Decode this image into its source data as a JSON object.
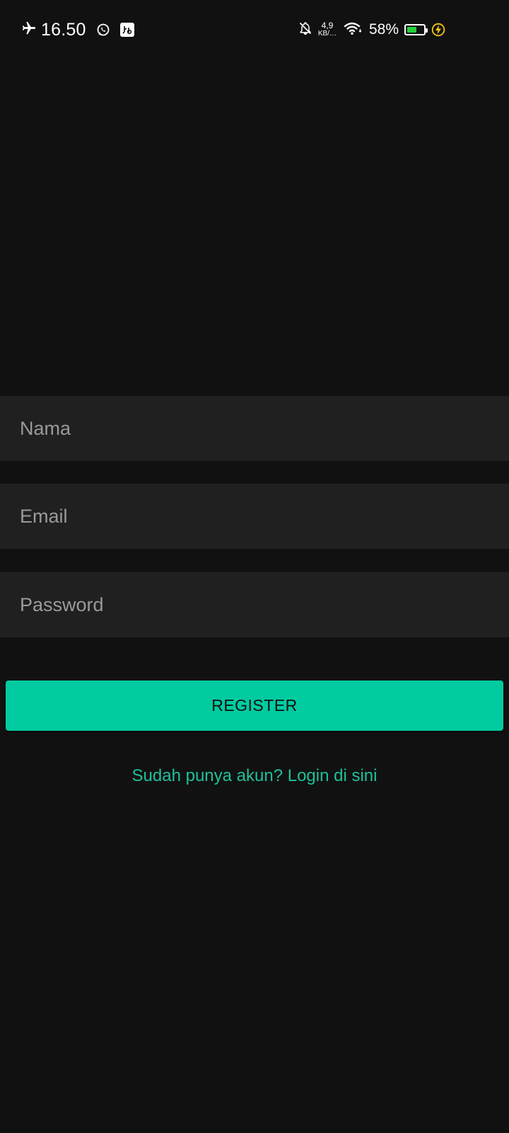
{
  "status_bar": {
    "time": "16.50",
    "airplane_icon": "airplane-icon",
    "apps": [
      "whatsapp-icon",
      "usb-debugging-icon"
    ],
    "mute_icon": "bell-off-icon",
    "net_speed_value": "4,9",
    "net_speed_unit": "KB/…",
    "wifi_icon": "wifi-icon",
    "battery_percent": "58%",
    "battery_level": 0.58,
    "charging_icon": "charging-icon",
    "colors": {
      "battery_fill": "#23d13a",
      "charging": "#f5c518"
    }
  },
  "form": {
    "name_placeholder": "Nama",
    "email_placeholder": "Email",
    "password_placeholder": "Password",
    "register_label": "REGISTER",
    "login_link": "Sudah punya akun? Login di sini"
  },
  "colors": {
    "background": "#111111",
    "field_background": "#202020",
    "accent": "#00cba0",
    "link": "#1fc09a"
  }
}
